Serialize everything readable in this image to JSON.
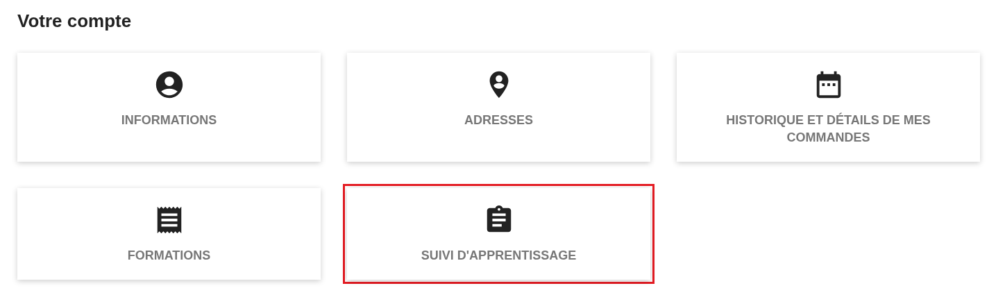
{
  "title": "Votre compte",
  "cards": [
    {
      "kind": "account",
      "label": "INFORMATIONS",
      "highlighted": false
    },
    {
      "kind": "address",
      "label": "ADRESSES",
      "highlighted": false
    },
    {
      "kind": "calendar",
      "label": "HISTORIQUE ET DÉTAILS DE MES COMMANDES",
      "highlighted": false
    },
    {
      "kind": "receipt",
      "label": "FORMATIONS",
      "highlighted": false
    },
    {
      "kind": "clipboard",
      "label": "SUIVI D'APPRENTISSAGE",
      "highlighted": true
    }
  ]
}
